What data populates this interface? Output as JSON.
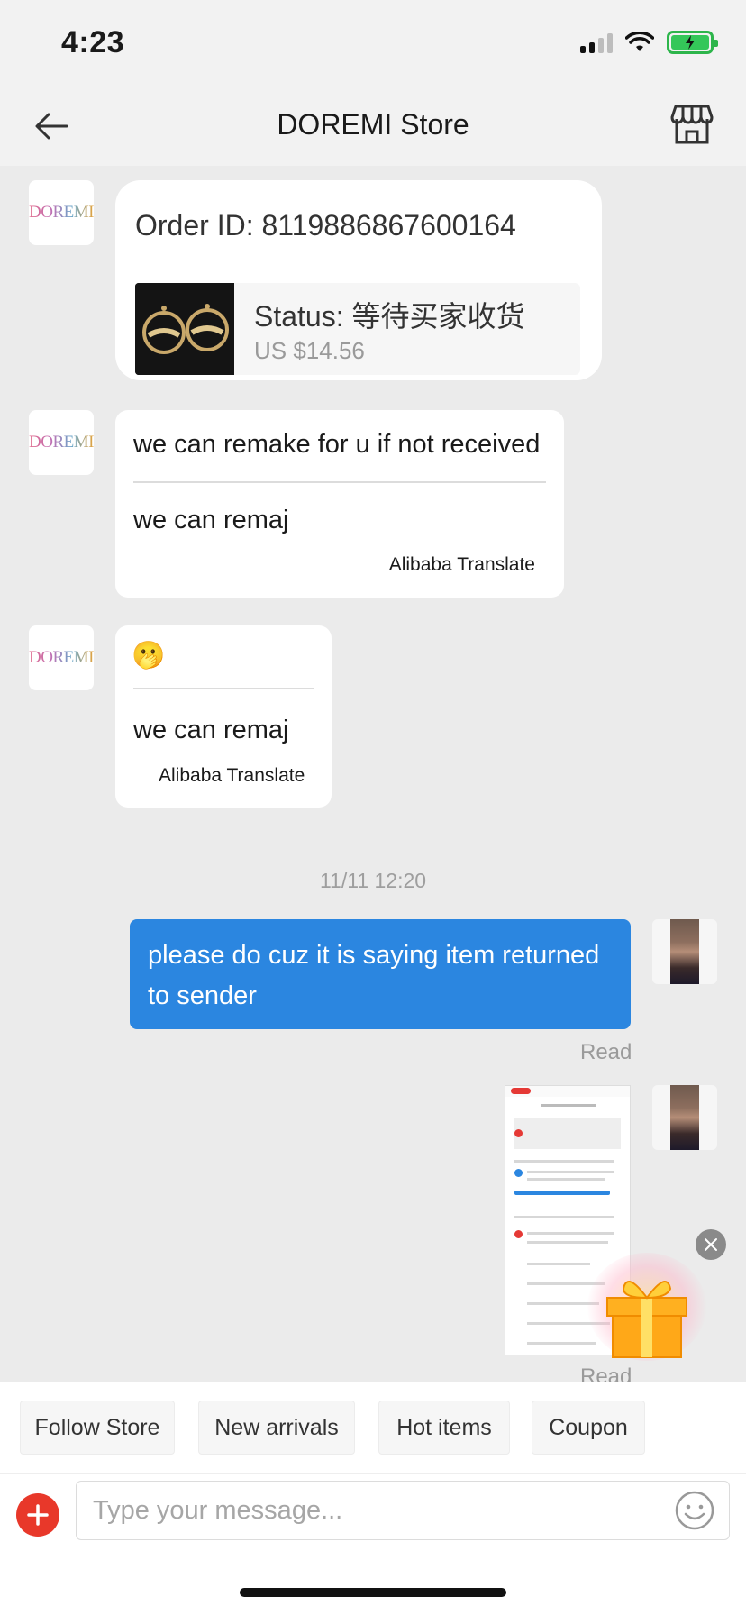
{
  "status_bar": {
    "time": "4:23"
  },
  "header": {
    "title": "DOREMI Store"
  },
  "store_avatar": {
    "text": "DOREMI"
  },
  "order_card": {
    "order_id": "Order ID: 8119886867600164",
    "status": "Status:  等待买家收货",
    "price": "US $14.56"
  },
  "messages": [
    {
      "original": "we can remake for u if not received",
      "translation": "we can remaj",
      "translate_label": "Alibaba Translate"
    },
    {
      "original": "🫢",
      "translation": "we can remaj",
      "translate_label": "Alibaba Translate"
    }
  ],
  "timestamp": "11/11 12:20",
  "my_message": {
    "text": "please do cuz it is saying item returned to sender",
    "read": "Read"
  },
  "screenshot_message": {
    "read": "Read"
  },
  "quick_actions": [
    "Follow Store",
    "New arrivals",
    "Hot items",
    "Coupon"
  ],
  "input": {
    "placeholder": "Type your message..."
  },
  "colors": {
    "accent_blue": "#2b86e0",
    "plus_red": "#e8382a",
    "chat_bg": "#ebebeb"
  }
}
